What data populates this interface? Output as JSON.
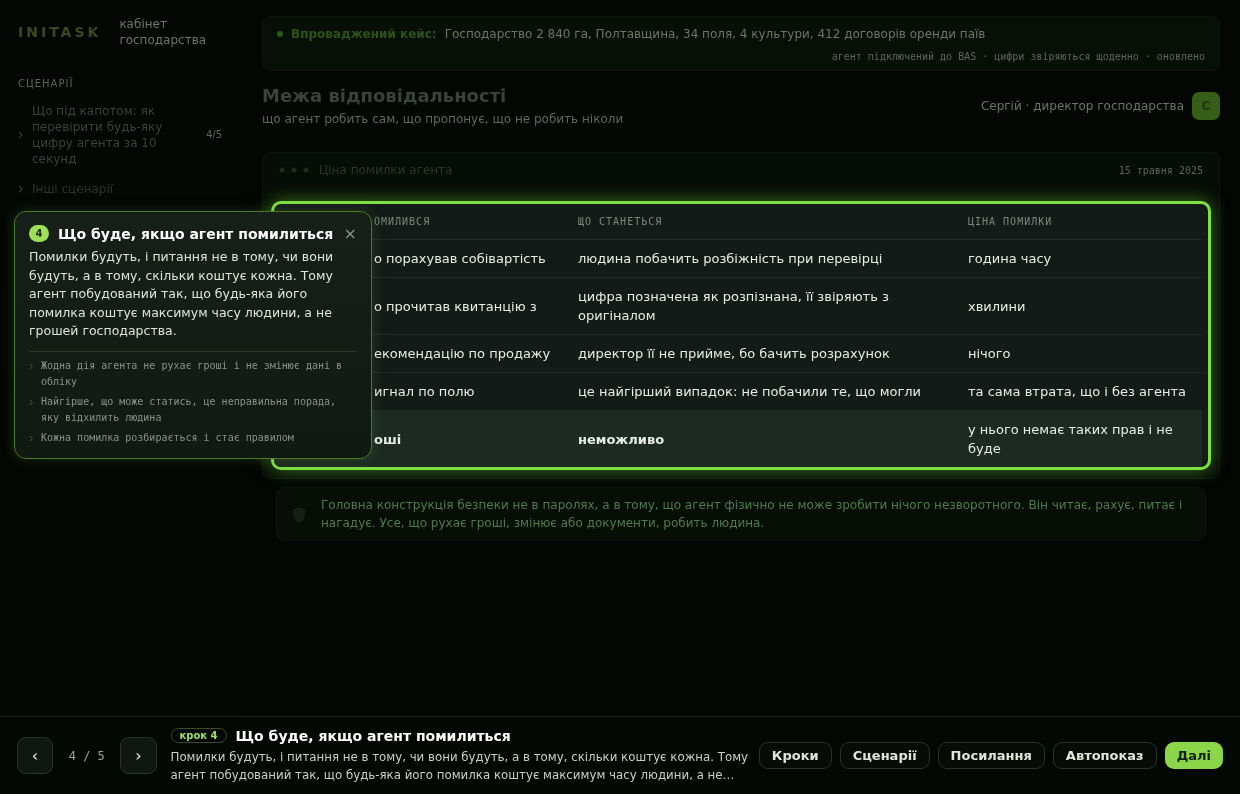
{
  "sidebar": {
    "logo": "INITASK",
    "subtitle": "кабінет господарства",
    "section": "СЦЕНАРІЇ",
    "items": [
      {
        "label": "Що під капотом: як перевірити будь-яку цифру агента за 10 секунд",
        "count": "4/5",
        "selected": true
      },
      {
        "label": "Інші сценарії",
        "selected": false
      }
    ]
  },
  "banner": {
    "label": "Впроваджений кейс:",
    "text": "Господарство 2 840 га, Полтавщина, 34 поля, 4 культури, 412 договорів оренди паїв",
    "meta": "агент підключений до BAS · цифри звіряються щоденно · оновлено"
  },
  "header": {
    "title": "Межа відповідальності",
    "subtitle": "що агент робить сам, що пропонує, що не робить ніколи",
    "user": "Сергій · директор господарства",
    "avatar": "С"
  },
  "card": {
    "title": "Ціна помилки агента",
    "meta": "15 травня 2025",
    "table": {
      "columns": [
        "ОМИЛИВСЯ",
        "ЩО СТАНЕТЬСЯ",
        "ЦІНА ПОМИЛКИ"
      ],
      "rows": [
        {
          "cells": [
            "о порахував собівартість",
            "людина побачить розбіжність при перевірці",
            "година часу"
          ],
          "highlighted": false
        },
        {
          "cells": [
            "о прочитав квитанцію з",
            "цифра позначена як розпізнана, її звіряють з оригіналом",
            "хвилини"
          ],
          "highlighted": false
        },
        {
          "cells": [
            "екомендацію по продажу",
            "директор її не прийме, бо бачить розрахунок",
            "нічого"
          ],
          "highlighted": false
        },
        {
          "cells": [
            "игнал по полю",
            "це найгірший випадок: не побачили те, що могли",
            "та сама втрата, що і без агента"
          ],
          "highlighted": false
        },
        {
          "cells": [
            "оші",
            "неможливо",
            "у нього немає таких прав і не буде"
          ],
          "highlighted": true
        }
      ]
    }
  },
  "note": "Головна конструкція безпеки не в паролях, а в тому, що агент фізично не може зробити нічого незворотного. Він читає, рахує, питає і нагадує. Усе, що рухає гроші, змінює або документи, робить людина.",
  "popover": {
    "badge": "4",
    "title": "Що буде, якщо агент помилиться",
    "close": "×",
    "body": "Помилки будуть, і питання не в тому, чи вони будуть, а в тому, скільки коштує кожна. Тому агент побудований так, що будь-яка його помилка коштує максимум часу людини, а не грошей господарства.",
    "points": [
      "Жодна дія агента не рухає гроші і не змінює дані в обліку",
      "Найгірше, що може статись, це неправильна порада, яку відхилить людина",
      "Кожна помилка розбирається і стає правилом"
    ]
  },
  "footer": {
    "prev": "‹",
    "progress": "4 / 5",
    "next": "›",
    "step": "крок 4",
    "title": "Що буде, якщо агент помилиться",
    "text": "Помилки будуть, і питання не в тому, чи вони будуть, а в тому, скільки коштує кожна. Тому агент побудований так, що будь-яка його помилка коштує максимум часу людини, а не…",
    "buttons": [
      {
        "label": "Кроки",
        "kind": "secondary"
      },
      {
        "label": "Сценарії",
        "kind": "secondary"
      },
      {
        "label": "Посилання",
        "kind": "secondary"
      },
      {
        "label": "Автопоказ",
        "kind": "secondary"
      },
      {
        "label": "Далі",
        "kind": "primary"
      }
    ]
  }
}
